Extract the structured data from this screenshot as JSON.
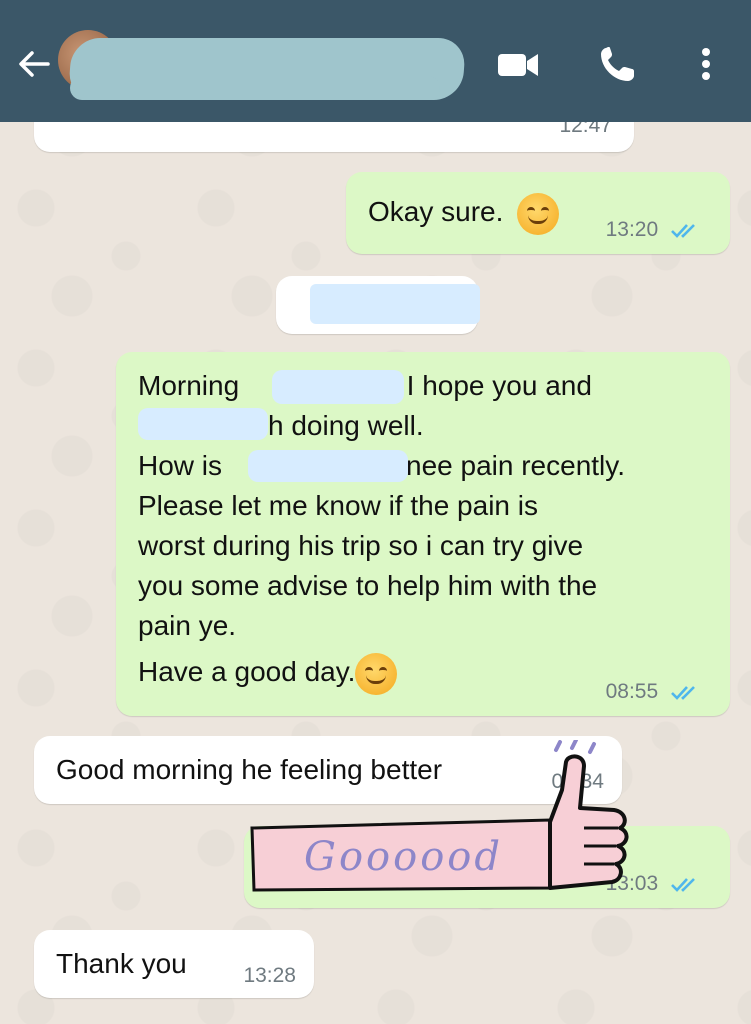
{
  "header": {
    "contact_name": "",
    "icons": [
      "back-arrow-icon",
      "video-call-icon",
      "phone-icon",
      "more-vert-icon"
    ]
  },
  "messages": {
    "prev_time": "12:47",
    "m1_text": "Okay sure.",
    "m1_time": "13:20",
    "m3_l1a": "Morning",
    "m3_l1b": "y. I hope you and",
    "m3_l2": "h doing well.",
    "m3_l3a": "How is",
    "m3_l3b": "knee pain recently.",
    "m3_l4": "Please let me know if the pain is",
    "m3_l5": "worst during his trip so i can try give",
    "m3_l6": "you some advise to help him with the",
    "m3_l7": "pain ye.",
    "m3_l8": "Have a good day.",
    "m3_time": "08:55",
    "m4_text": "Good morning he feeling better",
    "m4_time": "09:34",
    "m5_time": "13:03",
    "m6_text": "Thank you",
    "m6_time": "13:28"
  },
  "sticker": {
    "label": "Goooood"
  },
  "colors": {
    "header": "#3b5768",
    "outgoing_bubble": "#dcf8c6",
    "incoming_bubble": "#ffffff",
    "read_ticks": "#4fb6ec",
    "background": "#ece5dd"
  }
}
